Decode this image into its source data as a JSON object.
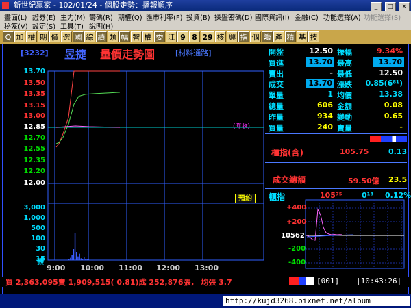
{
  "window": {
    "title": "新世紀贏家 - 102/01/24 - 個股走勢：播報順序",
    "buttons": [
      "_",
      "□",
      "×"
    ]
  },
  "menu": {
    "row1": [
      "畫面(L)",
      "證券(E)",
      "主力(M)",
      "籌碼(R)",
      "期權(Q)",
      "匯市利率(F)",
      "投資(B)",
      "操盤密碼(D)",
      "國際資訊(I)",
      "金融(C)",
      "功能選擇(A)",
      "功能選擇(S)"
    ],
    "row2": [
      "秘笈(V)",
      "設定(S)",
      "工具(T)",
      "說明(H)"
    ]
  },
  "toolbar": {
    "items": [
      "Q",
      "加",
      "權",
      "期",
      "價",
      "選",
      "國",
      "綜",
      "績",
      "類",
      "幅",
      "智",
      "權",
      "委",
      "江",
      "9",
      "8",
      "29",
      "核",
      "興",
      "指",
      "個",
      "籌",
      "產",
      "精",
      "基",
      "技"
    ]
  },
  "chart_header": {
    "code": "[3232]",
    "name": "昱捷",
    "title": "量價走勢圖",
    "link": "[材料通路]"
  },
  "annotations": {
    "flat_note": "(昨收)",
    "yellow_box": "預約"
  },
  "chart_data": [
    {
      "type": "line",
      "title": "量價走勢圖",
      "x_ticks": [
        "9:00",
        "10:00",
        "11:00",
        "12:00",
        "13:00"
      ],
      "y_ticks": [
        "13.70",
        "13.50",
        "13.35",
        "13.15",
        "13.00",
        "12.85",
        "12.70",
        "12.55",
        "12.35",
        "12.20",
        "12.00"
      ],
      "ylim": [
        12.0,
        13.7
      ],
      "series": [
        {
          "values": [
            12.55,
            12.6,
            12.75,
            13.0,
            13.7,
            13.7,
            13.7,
            13.7,
            13.7,
            13.7
          ]
        },
        {
          "values": [
            12.6,
            12.62,
            12.7,
            12.9,
            13.2,
            13.32,
            13.35,
            13.36,
            13.37,
            13.38
          ]
        }
      ]
    },
    {
      "type": "bar",
      "title": "",
      "y_ticks": [
        "3,000",
        "1,000",
        "500",
        "100",
        "30",
        "15",
        "張"
      ],
      "values": [
        10,
        25,
        60,
        120,
        300,
        90,
        40,
        70,
        20,
        15,
        35,
        10,
        8,
        12
      ]
    },
    {
      "type": "line",
      "title": "櫃指",
      "y_ticks": [
        "+400",
        "+200",
        "10562",
        "-200",
        "-400"
      ],
      "series": [
        {
          "values": [
            0,
            -20,
            -60,
            -70,
            380,
            300,
            120,
            40,
            20,
            10,
            15,
            10,
            12,
            10
          ]
        }
      ]
    }
  ],
  "quote": {
    "rows": [
      {
        "l1": "開盤",
        "v1": "12.50",
        "l2": "振幅",
        "v2": "9.34%"
      },
      {
        "l1": "買進",
        "v1": "13.70",
        "l2": "最高",
        "v2": "13.70"
      },
      {
        "l1": "賣出",
        "v1": "-",
        "l2": "最低",
        "v2": "12.50"
      },
      {
        "l1": "成交",
        "v1": "13.70",
        "l2": "漲跌",
        "v2": "0.85(6⁸¹)"
      },
      {
        "l1": "單量",
        "v1": "1",
        "l2": "均價",
        "v2": "13.38"
      },
      {
        "l1": "總量",
        "v1": "606",
        "l2": "金額",
        "v2": "0.08"
      },
      {
        "l1": "昨量",
        "v1": "934",
        "l2": "變動",
        "v2": "0.65"
      },
      {
        "l1": "買量",
        "v1": "240",
        "l2": "賣量",
        "v2": "-"
      }
    ],
    "otc_index_label": "櫃指(含)",
    "otc_index_value": "105.75",
    "otc_index_change": "0.13",
    "turnover_label": "成交總額",
    "turnover_value": "59.50億",
    "turnover_extra": "23.5",
    "mini_title": "櫃指",
    "mini_value": "105⁷⁵",
    "mini_change": "0¹³",
    "mini_pct": "0.12%"
  },
  "status": {
    "text": "買 2,363,095賣 1,909,515( 0.81)成 252,876張， 均張 3.7",
    "page": "001",
    "time": "10:43:26"
  },
  "footer": {
    "url": "http://kujd3268.pixnet.net/album"
  },
  "colors": {
    "price_line": "#ff4444",
    "avg_line": "#55dd55",
    "grid": "#3060ff",
    "bg": "#000000",
    "up": "#ff3333",
    "label_cyan": "#00ddff",
    "box_blue": "#00aaee"
  }
}
